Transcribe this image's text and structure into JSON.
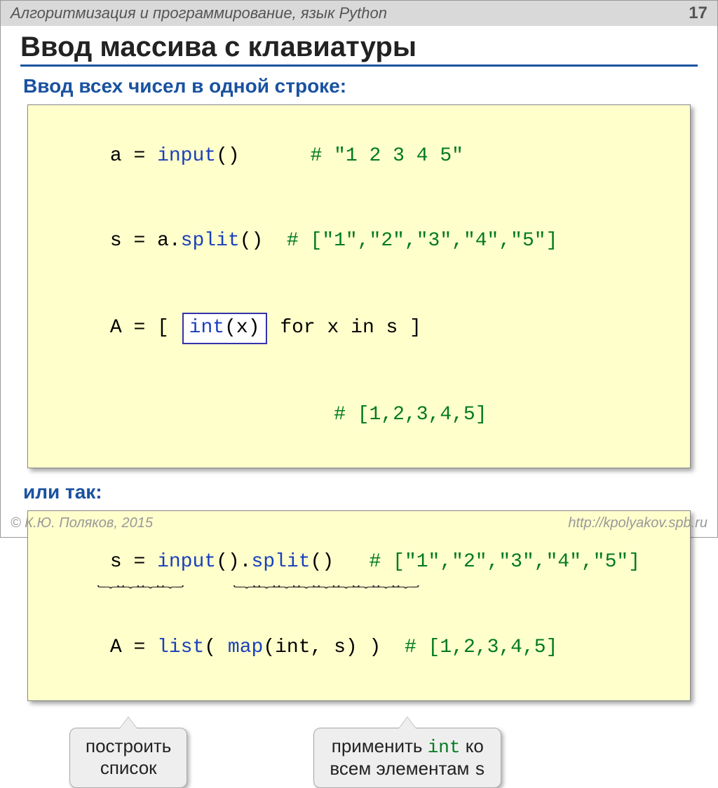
{
  "header": {
    "course_title": "Алгоритмизация и программирование, язык Python",
    "page_number": "17"
  },
  "slide_title": "Ввод массива с клавиатуры",
  "subheading1": "Ввод всех чисел в одной строке:",
  "code1": {
    "l1a": "a",
    "l1eq": " = ",
    "l1fn": "input",
    "l1p": "()",
    "l1pad": "      ",
    "l1c": "# \"1 2 3 4 5\"",
    "l2a": "s",
    "l2eq": " = ",
    "l2obj": "a.",
    "l2fn": "split",
    "l2p": "()",
    "l2pad": "  ",
    "l2c": "# [\"1\",\"2\",\"3\",\"4\",\"5\"]",
    "l3a": "A",
    "l3eq": " = ",
    "l3b": "[ ",
    "l3inset_fn": "int",
    "l3inset_arg": "(x)",
    "l3tail": " for x in s ]",
    "l4pad": "                   ",
    "l4c": "# [1,2,3,4,5]"
  },
  "or_label": "или так:",
  "code2": {
    "l1a": "s",
    "l1eq": " = ",
    "l1fn1": "input",
    "l1p1": "().",
    "l1fn2": "split",
    "l1p2": "()",
    "l1pad": "   ",
    "l1c": "# [\"1\",\"2\",\"3\",\"4\",\"5\"]",
    "l2a": "A",
    "l2eq": " = ",
    "l2fn": "list",
    "l2p1": "( ",
    "l2map": "map",
    "l2args": "(int, s) )",
    "l2pad": "  ",
    "l2c": "# [1,2,3,4,5]"
  },
  "callout1_l1": "построить",
  "callout1_l2": "список",
  "callout2_l1a": "применить ",
  "callout2_l1fn": "int",
  "callout2_l1b": " ко",
  "callout2_l2a": "всем элементам ",
  "callout2_l2s": "s",
  "footer": {
    "copyright": "© К.Ю. Поляков, 2015",
    "url": "http://kpolyakov.spb.ru"
  }
}
